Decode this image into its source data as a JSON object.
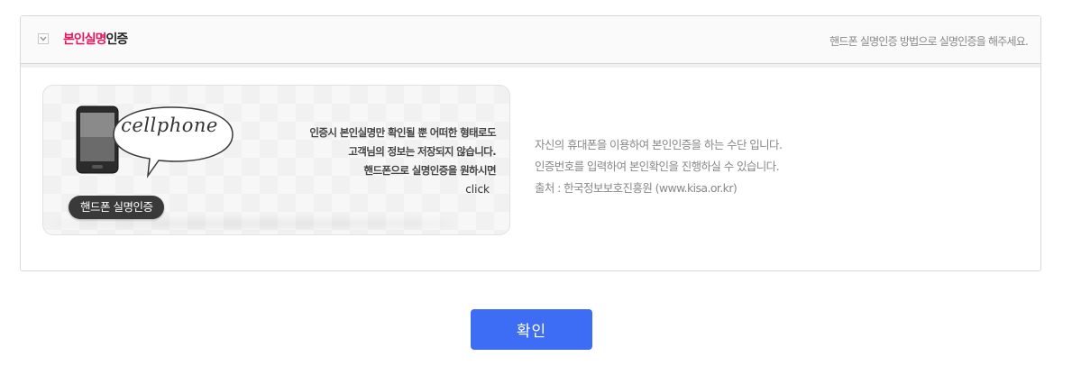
{
  "header": {
    "toggle_icon": "chevron-down-icon",
    "title_accent": "본인실명",
    "title_rest": "인증",
    "description": "핸드폰 실명인증 방법으로 실명인증을 해주세요."
  },
  "card": {
    "phone_icon": "cellphone-icon",
    "bubble_label": "cellphone",
    "lines": [
      "인증시 본인실명만 확인될 뿐 어떠한 형태로도",
      "고객님의 정보는 저장되지 않습니다.",
      "핸드폰으로 실명인증을 원하시면"
    ],
    "click_label": "click",
    "pill_label": "핸드폰 실명인증"
  },
  "info": {
    "lines": [
      "자신의 휴대폰을 이용하여 본인인증을 하는 수단 입니다.",
      "인증번호를 입력하여 본인확인을 진행하실 수 있습니다.",
      "출처 : 한국정보보호진흥원 (www.kisa.or.kr)"
    ]
  },
  "actions": {
    "confirm_label": "확인"
  },
  "colors": {
    "accent": "#e8175d",
    "button": "#3d6df5"
  }
}
